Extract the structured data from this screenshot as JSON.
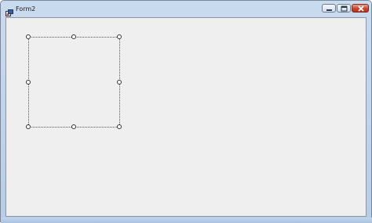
{
  "window": {
    "title": "Form2",
    "colors": {
      "frame": "#b7cde6",
      "client_area": "#efefef",
      "close_button": "#c8432e"
    }
  },
  "caption_buttons": {
    "minimize": "minimize-icon",
    "maximize": "maximize-icon",
    "close": "close-icon"
  }
}
